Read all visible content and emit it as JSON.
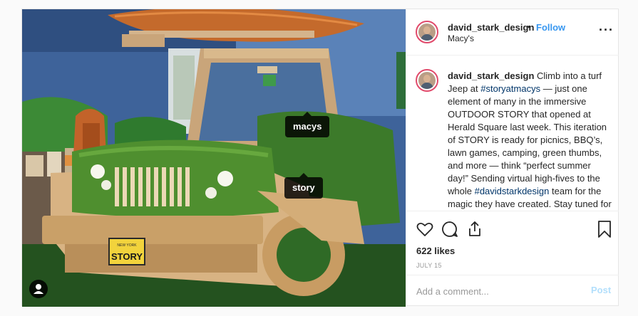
{
  "post": {
    "photo": {
      "alt_subject": "turf-covered wooden jeep",
      "plate_state": "NEW YORK",
      "plate_text": "STORY",
      "tags": [
        {
          "label": "macys"
        },
        {
          "label": "story"
        }
      ],
      "user_tag_icon": "user-tags-icon"
    },
    "header": {
      "username": "david_stark_design",
      "separator": "•",
      "follow_label": "Follow",
      "location": "Macy's",
      "more_icon": "more-options-icon"
    },
    "caption": {
      "username": "david_stark_design",
      "text_1": "Climb into a turf Jeep at",
      "hashtag_1": "#storyatmacys",
      "text_2": "— just one element of many in the immersive OUTDOOR STORY that opened at Herald Square last week. This iteration of STORY is ready for picnics, BBQ’s, lawn games, camping, green thumbs, and more — think “perfect summer day!” Sending virtual high-fives to the whole",
      "hashtag_2": "#davidstarkdesign",
      "text_3": "team for the magic they have created. Stay tuned for more images over the next days, weeks, and months!"
    },
    "actions": {
      "like_icon": "heart-icon",
      "comment_icon": "comment-icon",
      "share_icon": "share-icon",
      "save_icon": "bookmark-icon"
    },
    "likes": "622 likes",
    "date": "JULY 15",
    "comment": {
      "placeholder": "Add a comment...",
      "value": "",
      "post_label": "Post"
    }
  },
  "colors": {
    "follow": "#3897f0",
    "post_disabled": "#b2dffc",
    "hashtag": "#003569",
    "avatar_ring": "#e14a6b"
  }
}
